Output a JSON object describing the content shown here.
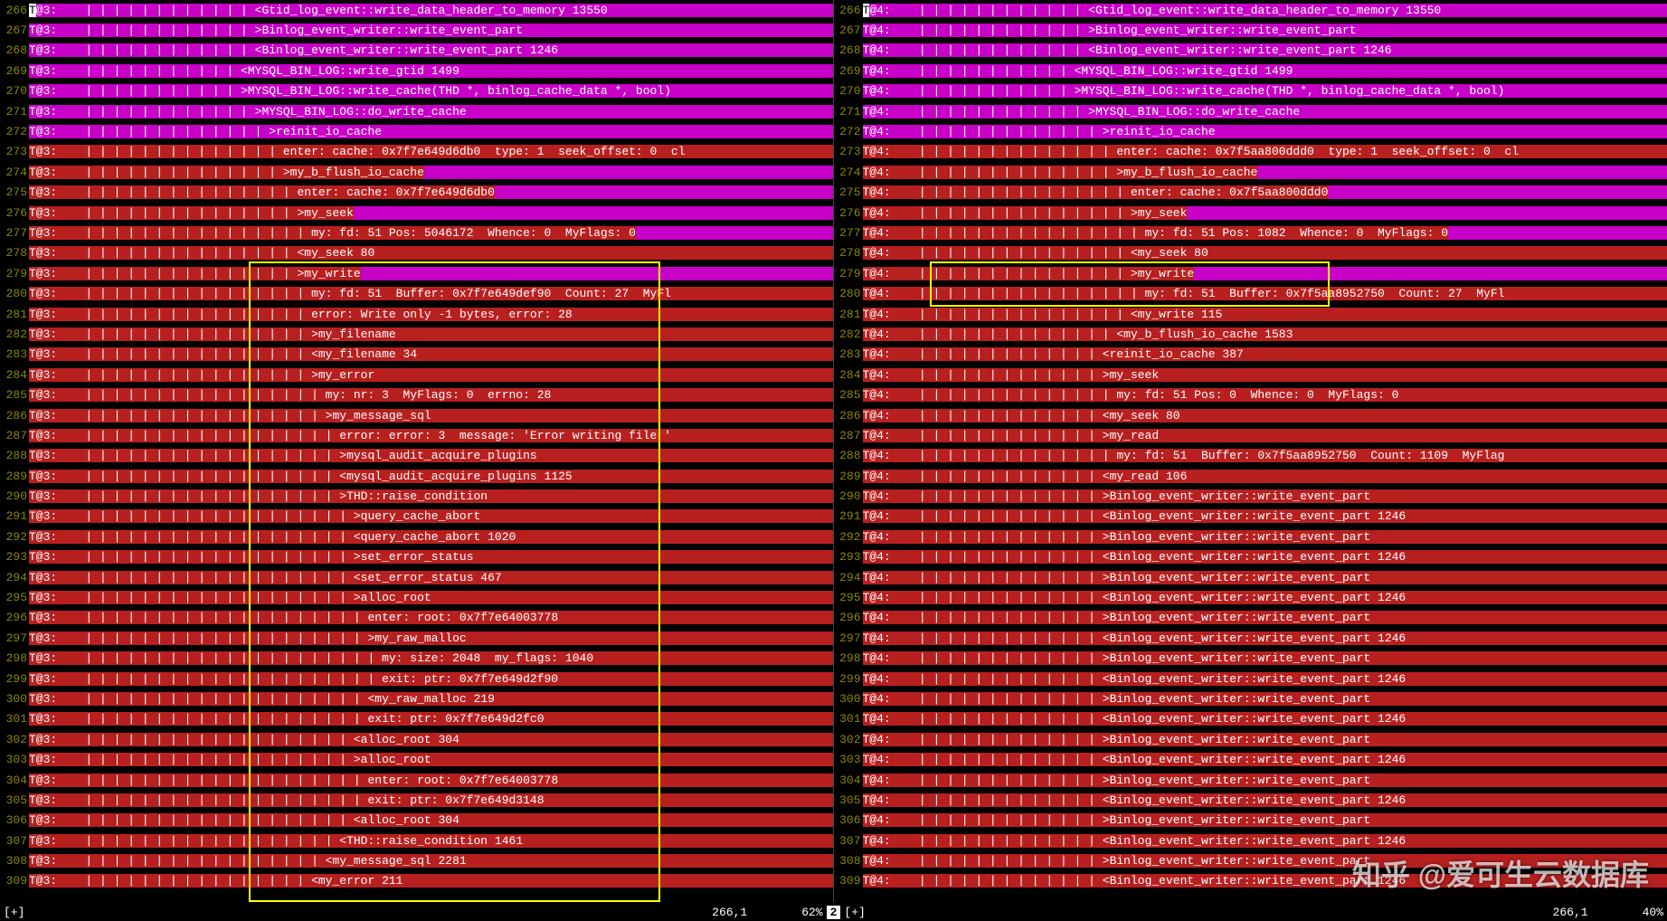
{
  "watermark": "知乎 @爱可生云数据库",
  "status": {
    "left_marker": "[+]",
    "left_pos": "266,1",
    "left_pct": "62%",
    "divider": "2",
    "right_marker": "[+]",
    "right_pos": "266,1",
    "right_pct": "40%"
  },
  "left": {
    "thread": "T@3:",
    "lines": [
      {
        "n": 266,
        "hl": "m",
        "pipes": 12,
        "text": "<Gtid_log_event::write_data_header_to_memory 13550",
        "cursor": true
      },
      {
        "n": 267,
        "hl": "m",
        "pipes": 12,
        "text": ">Binlog_event_writer::write_event_part"
      },
      {
        "n": 268,
        "hl": "m",
        "pipes": 12,
        "text": "<Binlog_event_writer::write_event_part 1246"
      },
      {
        "n": 269,
        "hl": "m",
        "pipes": 11,
        "text": "<MYSQL_BIN_LOG::write_gtid 1499"
      },
      {
        "n": 270,
        "hl": "m",
        "pipes": 11,
        "text": ">MYSQL_BIN_LOG::write_cache(THD *, binlog_cache_data *, bool)"
      },
      {
        "n": 271,
        "hl": "m",
        "pipes": 12,
        "text": ">MYSQL_BIN_LOG::do_write_cache"
      },
      {
        "n": 272,
        "hl": "m",
        "pipes": 13,
        "text": ">reinit_io_cache"
      },
      {
        "n": 273,
        "hl": "r",
        "pipes": 14,
        "text": "enter: cache: 0x7f7e649d6db0  type: 1  seek_offset: 0  cl"
      },
      {
        "n": 274,
        "hl": "r",
        "pipes": 14,
        "text": ">my_b_flush_io_cache",
        "tail_m": true
      },
      {
        "n": 275,
        "hl": "r",
        "pipes": 15,
        "text": "enter: cache: 0x7f7e649d6db0",
        "tail_m": true
      },
      {
        "n": 276,
        "hl": "r",
        "pipes": 15,
        "text": ">my_seek",
        "tail_m": true
      },
      {
        "n": 277,
        "hl": "r",
        "pipes": 16,
        "text": "my: fd: 51 Pos: 5046172  Whence: 0  MyFlags: 0",
        "tail_m": true
      },
      {
        "n": 278,
        "hl": "r",
        "pipes": 15,
        "text": "<my_seek 80"
      },
      {
        "n": 279,
        "hl": "r",
        "pipes": 15,
        "text": ">my_write",
        "tail_m": true
      },
      {
        "n": 280,
        "hl": "r",
        "pipes": 16,
        "text": "my: fd: 51  Buffer: 0x7f7e649def90  Count: 27  MyFl"
      },
      {
        "n": 281,
        "hl": "r",
        "pipes": 16,
        "text": "error: Write only -1 bytes, error: 28"
      },
      {
        "n": 282,
        "hl": "r",
        "pipes": 16,
        "text": ">my_filename"
      },
      {
        "n": 283,
        "hl": "r",
        "pipes": 16,
        "text": "<my_filename 34"
      },
      {
        "n": 284,
        "hl": "r",
        "pipes": 16,
        "text": ">my_error"
      },
      {
        "n": 285,
        "hl": "r",
        "pipes": 17,
        "text": "my: nr: 3  MyFlags: 0  errno: 28"
      },
      {
        "n": 286,
        "hl": "r",
        "pipes": 17,
        "text": ">my_message_sql"
      },
      {
        "n": 287,
        "hl": "r",
        "pipes": 18,
        "text": "error: error: 3  message: 'Error writing file '"
      },
      {
        "n": 288,
        "hl": "r",
        "pipes": 18,
        "text": ">mysql_audit_acquire_plugins"
      },
      {
        "n": 289,
        "hl": "r",
        "pipes": 18,
        "text": "<mysql_audit_acquire_plugins 1125"
      },
      {
        "n": 290,
        "hl": "r",
        "pipes": 18,
        "text": ">THD::raise_condition"
      },
      {
        "n": 291,
        "hl": "r",
        "pipes": 19,
        "text": ">query_cache_abort"
      },
      {
        "n": 292,
        "hl": "r",
        "pipes": 19,
        "text": "<query_cache_abort 1020"
      },
      {
        "n": 293,
        "hl": "r",
        "pipes": 19,
        "text": ">set_error_status"
      },
      {
        "n": 294,
        "hl": "r",
        "pipes": 19,
        "text": "<set_error_status 467"
      },
      {
        "n": 295,
        "hl": "r",
        "pipes": 19,
        "text": ">alloc_root"
      },
      {
        "n": 296,
        "hl": "r",
        "pipes": 20,
        "text": "enter: root: 0x7f7e64003778"
      },
      {
        "n": 297,
        "hl": "r",
        "pipes": 20,
        "text": ">my_raw_malloc"
      },
      {
        "n": 298,
        "hl": "r",
        "pipes": 21,
        "text": "my: size: 2048  my_flags: 1040"
      },
      {
        "n": 299,
        "hl": "r",
        "pipes": 21,
        "text": "exit: ptr: 0x7f7e649d2f90"
      },
      {
        "n": 300,
        "hl": "r",
        "pipes": 20,
        "text": "<my_raw_malloc 219"
      },
      {
        "n": 301,
        "hl": "r",
        "pipes": 20,
        "text": "exit: ptr: 0x7f7e649d2fc0"
      },
      {
        "n": 302,
        "hl": "r",
        "pipes": 19,
        "text": "<alloc_root 304"
      },
      {
        "n": 303,
        "hl": "r",
        "pipes": 19,
        "text": ">alloc_root"
      },
      {
        "n": 304,
        "hl": "r",
        "pipes": 20,
        "text": "enter: root: 0x7f7e64003778"
      },
      {
        "n": 305,
        "hl": "r",
        "pipes": 20,
        "text": "exit: ptr: 0x7f7e649d3148"
      },
      {
        "n": 306,
        "hl": "r",
        "pipes": 19,
        "text": "<alloc_root 304"
      },
      {
        "n": 307,
        "hl": "r",
        "pipes": 18,
        "text": "<THD::raise_condition 1461"
      },
      {
        "n": 308,
        "hl": "r",
        "pipes": 17,
        "text": "<my_message_sql 2281"
      },
      {
        "n": 309,
        "hl": "r",
        "pipes": 16,
        "text": "<my_error 211"
      }
    ]
  },
  "right": {
    "thread": "T@4:",
    "lines": [
      {
        "n": 266,
        "hl": "m",
        "pipes": 12,
        "text": "<Gtid_log_event::write_data_header_to_memory 13550",
        "cursor": true
      },
      {
        "n": 267,
        "hl": "m",
        "pipes": 12,
        "text": ">Binlog_event_writer::write_event_part"
      },
      {
        "n": 268,
        "hl": "m",
        "pipes": 12,
        "text": "<Binlog_event_writer::write_event_part 1246"
      },
      {
        "n": 269,
        "hl": "m",
        "pipes": 11,
        "text": "<MYSQL_BIN_LOG::write_gtid 1499"
      },
      {
        "n": 270,
        "hl": "m",
        "pipes": 11,
        "text": ">MYSQL_BIN_LOG::write_cache(THD *, binlog_cache_data *, bool)"
      },
      {
        "n": 271,
        "hl": "m",
        "pipes": 12,
        "text": ">MYSQL_BIN_LOG::do_write_cache"
      },
      {
        "n": 272,
        "hl": "m",
        "pipes": 13,
        "text": ">reinit_io_cache"
      },
      {
        "n": 273,
        "hl": "r",
        "pipes": 14,
        "text": "enter: cache: 0x7f5aa800ddd0  type: 1  seek_offset: 0  cl"
      },
      {
        "n": 274,
        "hl": "r",
        "pipes": 14,
        "text": ">my_b_flush_io_cache",
        "tail_m": true
      },
      {
        "n": 275,
        "hl": "r",
        "pipes": 15,
        "text": "enter: cache: 0x7f5aa800ddd0",
        "tail_m": true
      },
      {
        "n": 276,
        "hl": "r",
        "pipes": 15,
        "text": ">my_seek",
        "tail_m": true
      },
      {
        "n": 277,
        "hl": "r",
        "pipes": 16,
        "text": "my: fd: 51 Pos: 1082  Whence: 0  MyFlags: 0",
        "tail_m": true
      },
      {
        "n": 278,
        "hl": "r",
        "pipes": 15,
        "text": "<my_seek 80"
      },
      {
        "n": 279,
        "hl": "r",
        "pipes": 15,
        "text": ">my_write",
        "tail_m": true
      },
      {
        "n": 280,
        "hl": "r",
        "pipes": 16,
        "text": "my: fd: 51  Buffer: 0x7f5aa8952750  Count: 27  MyFl"
      },
      {
        "n": 281,
        "hl": "r",
        "pipes": 15,
        "text": "<my_write 115"
      },
      {
        "n": 282,
        "hl": "r",
        "pipes": 14,
        "text": "<my_b_flush_io_cache 1583"
      },
      {
        "n": 283,
        "hl": "r",
        "pipes": 13,
        "text": "<reinit_io_cache 387"
      },
      {
        "n": 284,
        "hl": "r",
        "pipes": 13,
        "text": ">my_seek"
      },
      {
        "n": 285,
        "hl": "r",
        "pipes": 14,
        "text": "my: fd: 51 Pos: 0  Whence: 0  MyFlags: 0"
      },
      {
        "n": 286,
        "hl": "r",
        "pipes": 13,
        "text": "<my_seek 80"
      },
      {
        "n": 287,
        "hl": "r",
        "pipes": 13,
        "text": ">my_read"
      },
      {
        "n": 288,
        "hl": "r",
        "pipes": 14,
        "text": "my: fd: 51  Buffer: 0x7f5aa8952750  Count: 1109  MyFlag"
      },
      {
        "n": 289,
        "hl": "r",
        "pipes": 13,
        "text": "<my_read 106"
      },
      {
        "n": 290,
        "hl": "r",
        "pipes": 13,
        "text": ">Binlog_event_writer::write_event_part"
      },
      {
        "n": 291,
        "hl": "r",
        "pipes": 13,
        "text": "<Binlog_event_writer::write_event_part 1246"
      },
      {
        "n": 292,
        "hl": "r",
        "pipes": 13,
        "text": ">Binlog_event_writer::write_event_part"
      },
      {
        "n": 293,
        "hl": "r",
        "pipes": 13,
        "text": "<Binlog_event_writer::write_event_part 1246"
      },
      {
        "n": 294,
        "hl": "r",
        "pipes": 13,
        "text": ">Binlog_event_writer::write_event_part"
      },
      {
        "n": 295,
        "hl": "r",
        "pipes": 13,
        "text": "<Binlog_event_writer::write_event_part 1246"
      },
      {
        "n": 296,
        "hl": "r",
        "pipes": 13,
        "text": ">Binlog_event_writer::write_event_part"
      },
      {
        "n": 297,
        "hl": "r",
        "pipes": 13,
        "text": "<Binlog_event_writer::write_event_part 1246"
      },
      {
        "n": 298,
        "hl": "r",
        "pipes": 13,
        "text": ">Binlog_event_writer::write_event_part"
      },
      {
        "n": 299,
        "hl": "r",
        "pipes": 13,
        "text": "<Binlog_event_writer::write_event_part 1246"
      },
      {
        "n": 300,
        "hl": "r",
        "pipes": 13,
        "text": ">Binlog_event_writer::write_event_part"
      },
      {
        "n": 301,
        "hl": "r",
        "pipes": 13,
        "text": "<Binlog_event_writer::write_event_part 1246"
      },
      {
        "n": 302,
        "hl": "r",
        "pipes": 13,
        "text": ">Binlog_event_writer::write_event_part"
      },
      {
        "n": 303,
        "hl": "r",
        "pipes": 13,
        "text": "<Binlog_event_writer::write_event_part 1246"
      },
      {
        "n": 304,
        "hl": "r",
        "pipes": 13,
        "text": ">Binlog_event_writer::write_event_part"
      },
      {
        "n": 305,
        "hl": "r",
        "pipes": 13,
        "text": "<Binlog_event_writer::write_event_part 1246"
      },
      {
        "n": 306,
        "hl": "r",
        "pipes": 13,
        "text": ">Binlog_event_writer::write_event_part"
      },
      {
        "n": 307,
        "hl": "r",
        "pipes": 13,
        "text": "<Binlog_event_writer::write_event_part 1246"
      },
      {
        "n": 308,
        "hl": "r",
        "pipes": 13,
        "text": ">Binlog_event_writer::write_event_part"
      },
      {
        "n": 309,
        "hl": "r",
        "pipes": 13,
        "text": "<Binlog_event_writer::write_event_part 1246"
      }
    ]
  }
}
